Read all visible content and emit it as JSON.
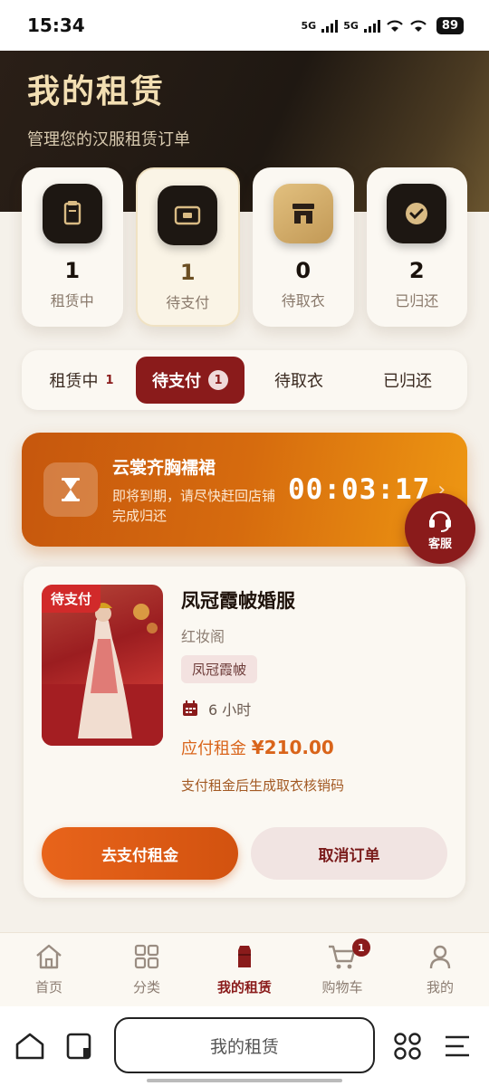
{
  "status_bar": {
    "time": "15:34",
    "network_1": "5G",
    "network_2": "5G",
    "battery": "89"
  },
  "header": {
    "title": "我的租赁",
    "subtitle": "管理您的汉服租赁订单"
  },
  "stats": [
    {
      "count": "1",
      "label": "租赁中",
      "icon": "jar-icon"
    },
    {
      "count": "1",
      "label": "待支付",
      "icon": "payment-icon"
    },
    {
      "count": "0",
      "label": "待取衣",
      "icon": "store-icon"
    },
    {
      "count": "2",
      "label": "已归还",
      "icon": "check-circle-icon"
    }
  ],
  "tabs": [
    {
      "label": "租赁中",
      "count": "1"
    },
    {
      "label": "待支付",
      "count": "1"
    },
    {
      "label": "待取衣",
      "count": ""
    },
    {
      "label": "已归还",
      "count": ""
    }
  ],
  "banner": {
    "title": "云裳齐胸襦裙",
    "desc": "即将到期，请尽快赶回店铺完成归还",
    "countdown": "00:03:17"
  },
  "customer_service": {
    "label": "客服"
  },
  "order": {
    "badge": "待支付",
    "name": "凤冠霞帔婚服",
    "shop": "红妆阁",
    "tag": "凤冠霞帔",
    "duration": "6 小时",
    "price_label": "应付租金",
    "price": "¥210.00",
    "note": "支付租金后生成取衣核销码",
    "pay_button": "去支付租金",
    "cancel_button": "取消订单"
  },
  "bottom_nav": [
    {
      "label": "首页",
      "icon": "home-icon"
    },
    {
      "label": "分类",
      "icon": "grid-icon"
    },
    {
      "label": "我的租赁",
      "icon": "robe-icon"
    },
    {
      "label": "购物车",
      "icon": "cart-icon",
      "badge": "1"
    },
    {
      "label": "我的",
      "icon": "user-icon"
    }
  ],
  "browser": {
    "address": "我的租赁"
  },
  "colors": {
    "accent": "#8a1b1b",
    "orange": "#d9641a",
    "gold": "#c29956",
    "dark": "#1d1712"
  }
}
